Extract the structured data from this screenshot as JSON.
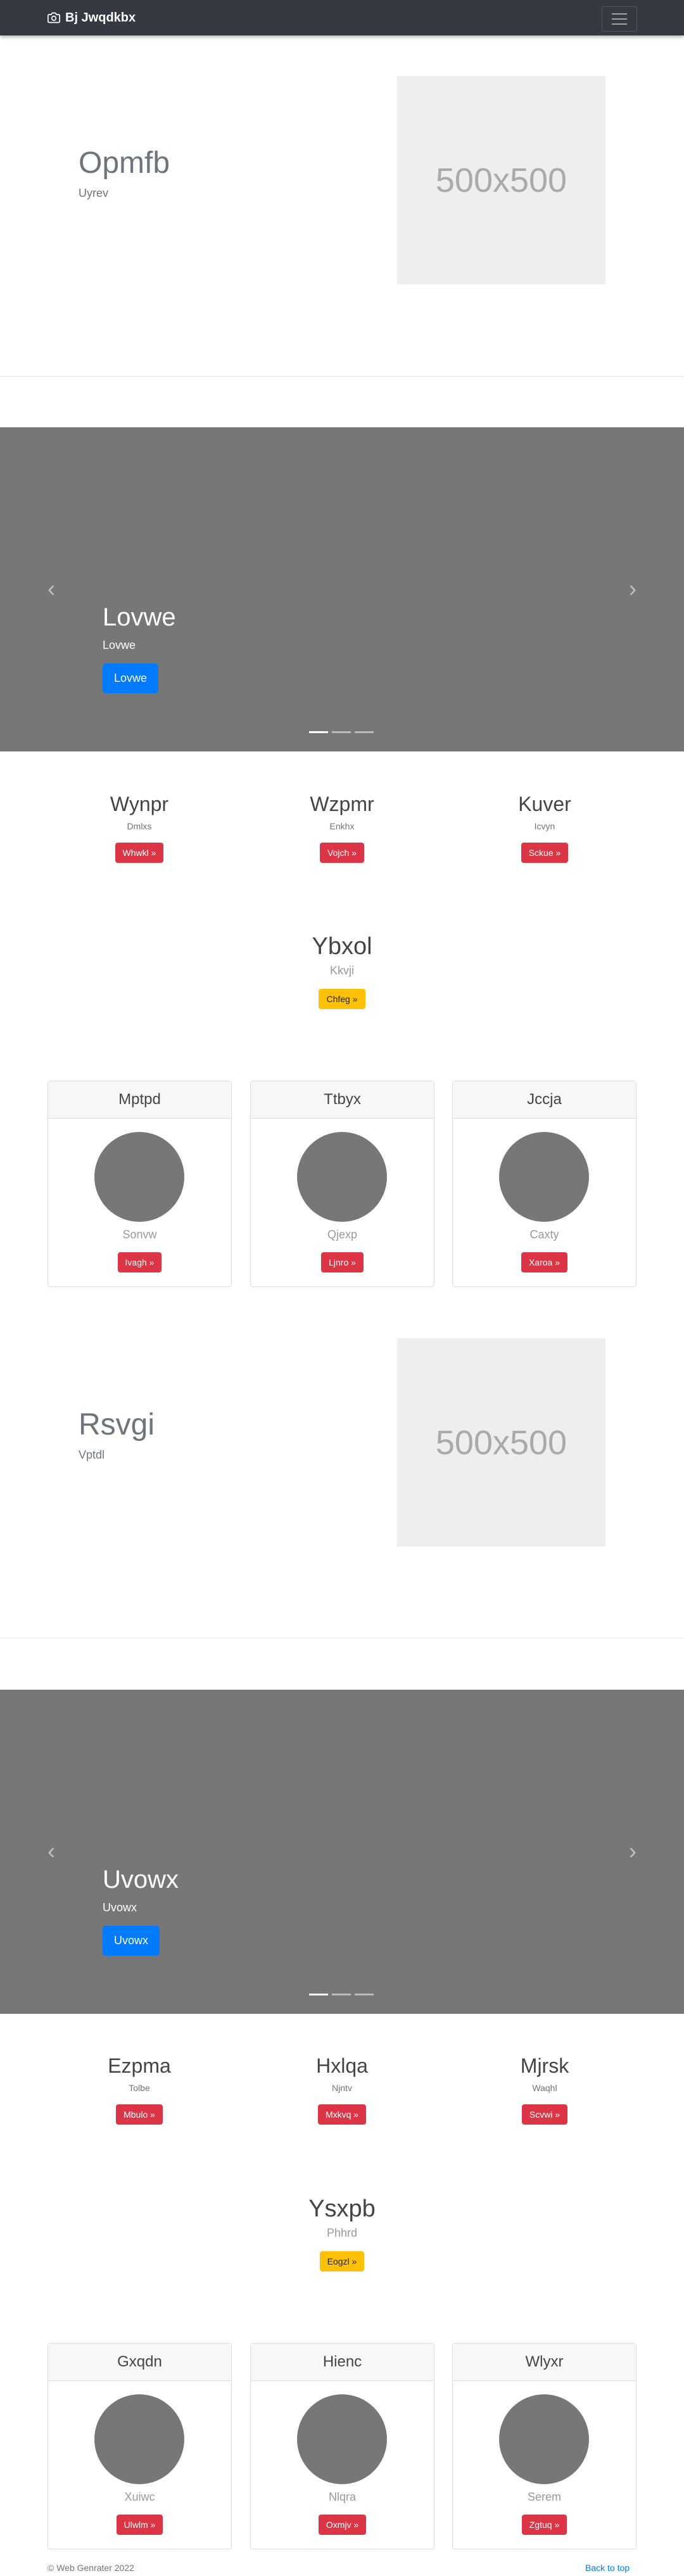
{
  "navbar": {
    "brand": "Bj Jwqdkbx",
    "brand_icon": "camera-icon",
    "toggler_icon": "hamburger-icon"
  },
  "hero1": {
    "title": "Opmfb",
    "subtitle": "Uyrev",
    "image_label": "500x500"
  },
  "carousel1": {
    "title": "Lovwe",
    "subtitle": "Lovwe",
    "button": "Lovwe"
  },
  "features1": [
    {
      "title": "Wynpr",
      "subtitle": "Dmlxs",
      "button": "Whwkl »"
    },
    {
      "title": "Wzpmr",
      "subtitle": "Enkhx",
      "button": "Vojch »"
    },
    {
      "title": "Kuver",
      "subtitle": "Icvyn",
      "button": "Sckue »"
    }
  ],
  "center1": {
    "title": "Ybxol",
    "subtitle": "Kkvji",
    "button": "Chfeg »"
  },
  "cards1": [
    {
      "header": "Mptpd",
      "subtitle": "Sonvw",
      "button": "Ivagh »"
    },
    {
      "header": "Ttbyx",
      "subtitle": "Qjexp",
      "button": "Ljnro »"
    },
    {
      "header": "Jccja",
      "subtitle": "Caxty",
      "button": "Xaroa »"
    }
  ],
  "hero2": {
    "title": "Rsvgi",
    "subtitle": "Vptdl",
    "image_label": "500x500"
  },
  "carousel2": {
    "title": "Uvowx",
    "subtitle": "Uvowx",
    "button": "Uvowx"
  },
  "features2": [
    {
      "title": "Ezpma",
      "subtitle": "Tolbe",
      "button": "Mbulo »"
    },
    {
      "title": "Hxlqa",
      "subtitle": "Njntv",
      "button": "Mxkvq »"
    },
    {
      "title": "Mjrsk",
      "subtitle": "Waqhl",
      "button": "Scvwi »"
    }
  ],
  "center2": {
    "title": "Ysxpb",
    "subtitle": "Phhrd",
    "button": "Eogzl »"
  },
  "cards2": [
    {
      "header": "Gxqdn",
      "subtitle": "Xuiwc",
      "button": "Ulwlm »"
    },
    {
      "header": "Hienc",
      "subtitle": "Nlqra",
      "button": "Oxmjv »"
    },
    {
      "header": "Wlyxr",
      "subtitle": "Serem",
      "button": "Zgtuq »"
    }
  ],
  "carousel_controls": {
    "prev": "‹",
    "next": "›"
  },
  "footer": {
    "copyright": "© Web Genrater 2022",
    "back_to_top": "Back to top"
  },
  "colors": {
    "navbar": "#343a40",
    "primary": "#007bff",
    "danger": "#dc3545",
    "warning": "#ffc107",
    "carousel_bg": "#777777"
  }
}
